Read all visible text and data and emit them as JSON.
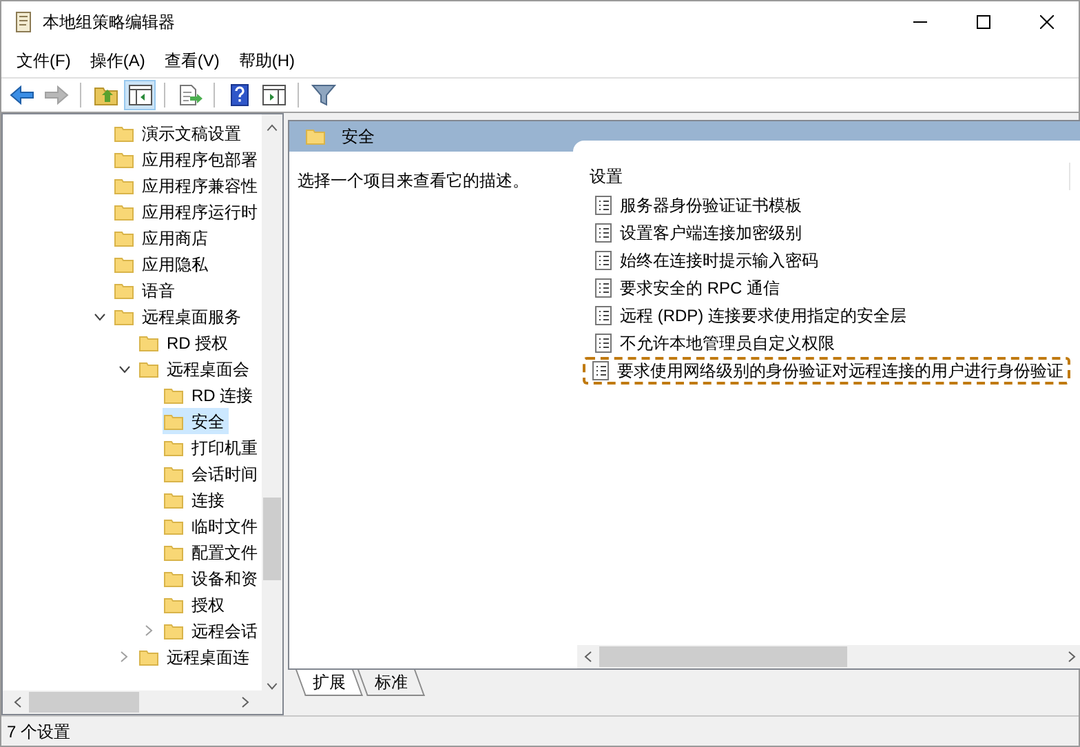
{
  "window": {
    "title": "本地组策略编辑器"
  },
  "menu": [
    "文件(F)",
    "操作(A)",
    "查看(V)",
    "帮助(H)"
  ],
  "toolbar": [
    {
      "kind": "back",
      "disabled": false,
      "pressed": false
    },
    {
      "kind": "forward",
      "disabled": true,
      "pressed": false
    },
    {
      "kind": "sep"
    },
    {
      "kind": "up",
      "disabled": false,
      "pressed": false
    },
    {
      "kind": "tree",
      "disabled": false,
      "pressed": true
    },
    {
      "kind": "sep"
    },
    {
      "kind": "export",
      "disabled": false,
      "pressed": false
    },
    {
      "kind": "sep"
    },
    {
      "kind": "help",
      "disabled": false,
      "pressed": false
    },
    {
      "kind": "panel",
      "disabled": false,
      "pressed": false
    },
    {
      "kind": "sep"
    },
    {
      "kind": "filter",
      "disabled": false,
      "pressed": false
    }
  ],
  "tree": [
    {
      "label": "演示文稿设置",
      "selected": false
    },
    {
      "label": "应用程序包部署",
      "selected": false
    },
    {
      "label": "应用程序兼容性",
      "selected": false
    },
    {
      "label": "应用程序运行时",
      "selected": false
    },
    {
      "label": "应用商店",
      "selected": false
    },
    {
      "label": "应用隐私",
      "selected": false
    },
    {
      "label": "语音",
      "selected": false
    },
    {
      "label": "远程桌面服务",
      "selected": false,
      "expanded": true,
      "children": [
        {
          "label": "RD 授权",
          "selected": false
        },
        {
          "label": "远程桌面会",
          "selected": false,
          "expanded": true,
          "children": [
            {
              "label": "RD 连接",
              "selected": false
            },
            {
              "label": "安全",
              "selected": true
            },
            {
              "label": "打印机重",
              "selected": false
            },
            {
              "label": "会话时间",
              "selected": false
            },
            {
              "label": "连接",
              "selected": false
            },
            {
              "label": "临时文件",
              "selected": false
            },
            {
              "label": "配置文件",
              "selected": false
            },
            {
              "label": "设备和资",
              "selected": false
            },
            {
              "label": "授权",
              "selected": false
            },
            {
              "label": "远程会话",
              "selected": false,
              "expanded": false
            }
          ]
        },
        {
          "label": "远程桌面连",
          "selected": false,
          "expanded": false
        }
      ]
    }
  ],
  "panel": {
    "title": "安全",
    "description": "选择一个项目来查看它的描述。",
    "column": "设置",
    "rows": [
      {
        "label": "服务器身份验证证书模板",
        "selected": false
      },
      {
        "label": "设置客户端连接加密级别",
        "selected": false
      },
      {
        "label": "始终在连接时提示输入密码",
        "selected": false
      },
      {
        "label": "要求安全的 RPC 通信",
        "selected": false
      },
      {
        "label": "远程 (RDP) 连接要求使用指定的安全层",
        "selected": false
      },
      {
        "label": "不允许本地管理员自定义权限",
        "selected": false
      },
      {
        "label": "要求使用网络级别的身份验证对远程连接的用户进行身份验证",
        "selected": true
      }
    ]
  },
  "tabs": [
    {
      "label": "扩展",
      "selected": true
    },
    {
      "label": "标准",
      "selected": false
    }
  ],
  "status_bar": "7 个设置"
}
